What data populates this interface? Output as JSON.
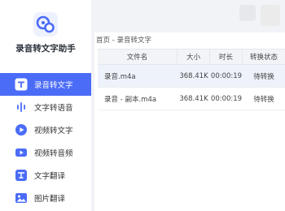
{
  "app": {
    "title": "录音转文字助手",
    "logo_icon": "chat-bubbles-icon",
    "accent": "#4b6cf7"
  },
  "sidebar": {
    "items": [
      {
        "label": "录音转文字",
        "icon": "text-t-icon",
        "active": true
      },
      {
        "label": "文字转语音",
        "icon": "sound-wave-icon",
        "active": false
      },
      {
        "label": "视频转文字",
        "icon": "video-play-icon",
        "active": false
      },
      {
        "label": "视频转音频",
        "icon": "video-audio-icon",
        "active": false
      },
      {
        "label": "文字翻译",
        "icon": "translate-icon",
        "active": false
      },
      {
        "label": "图片翻译",
        "icon": "image-icon",
        "active": false
      }
    ]
  },
  "breadcrumb": "首页 - 录音转文字",
  "table": {
    "headers": [
      "文件名",
      "大小",
      "时长",
      "转换状态"
    ],
    "rows": [
      {
        "name": "录音.m4a",
        "size": "368.41K",
        "duration": "00:00:19",
        "status": "待转换",
        "selected": true
      },
      {
        "name": "录音 - 副本.m4a",
        "size": "368.41K",
        "duration": "00:00:19",
        "status": "待转换",
        "selected": false
      }
    ]
  }
}
